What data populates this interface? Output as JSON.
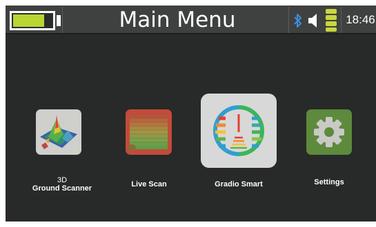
{
  "statusbar": {
    "title": "Main Menu",
    "time": "18:46",
    "battery_level": 0.8,
    "icons": [
      "battery-icon",
      "bluetooth-icon",
      "volume-icon",
      "signal-icon"
    ]
  },
  "menu": {
    "items": [
      {
        "label_line1": "3D",
        "label_line2": "Ground Scanner",
        "icon": "ground-scanner-3d-icon"
      },
      {
        "label": "Live Scan",
        "icon": "live-scan-icon"
      },
      {
        "label": "Gradio Smart",
        "icon": "gradio-smart-icon",
        "selected": true
      },
      {
        "label": "Settings",
        "icon": "gear-icon"
      }
    ]
  },
  "colors": {
    "background": "#272a28",
    "statusbar": "#3e413f",
    "battery_fill": "#b7d632",
    "settings_green": "#5d8a3c",
    "live_scan_frame": "#c24b3a"
  }
}
